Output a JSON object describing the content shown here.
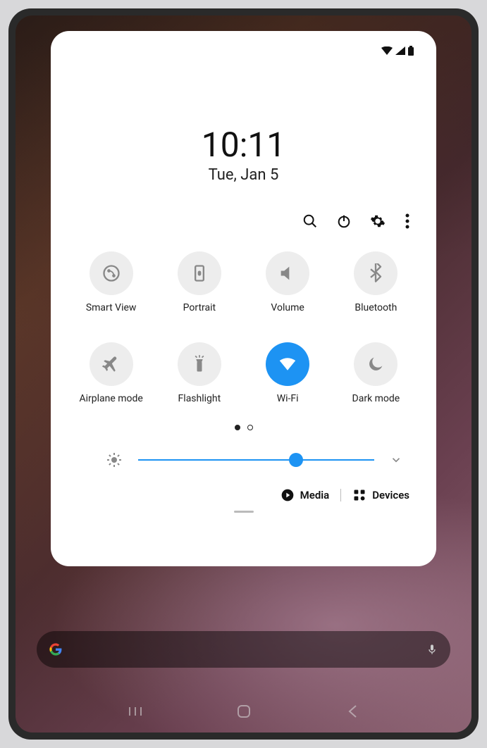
{
  "status": {
    "time": "10:11",
    "date": "Tue, Jan 5"
  },
  "actions": {
    "search": "search",
    "power": "power",
    "settings": "settings",
    "more": "more"
  },
  "tiles": [
    {
      "id": "smart-view",
      "label": "Smart View",
      "icon": "smartview",
      "on": false
    },
    {
      "id": "portrait",
      "label": "Portrait",
      "icon": "portrait",
      "on": false
    },
    {
      "id": "volume",
      "label": "Volume",
      "icon": "volume",
      "on": false
    },
    {
      "id": "bluetooth",
      "label": "Bluetooth",
      "icon": "bluetooth",
      "on": false
    },
    {
      "id": "airplane",
      "label": "Airplane mode",
      "icon": "airplane",
      "on": false
    },
    {
      "id": "flashlight",
      "label": "Flashlight",
      "icon": "flashlight",
      "on": false
    },
    {
      "id": "wifi",
      "label": "Wi-Fi",
      "icon": "wifi",
      "on": true
    },
    {
      "id": "darkmode",
      "label": "Dark mode",
      "icon": "darkmode",
      "on": false
    }
  ],
  "pager": {
    "pages": 2,
    "current": 0
  },
  "brightness": {
    "value": 67
  },
  "bottom": {
    "media": "Media",
    "devices": "Devices"
  },
  "colors": {
    "accent": "#1D93F3",
    "tileOff": "#ededed",
    "iconOff": "#888888"
  }
}
